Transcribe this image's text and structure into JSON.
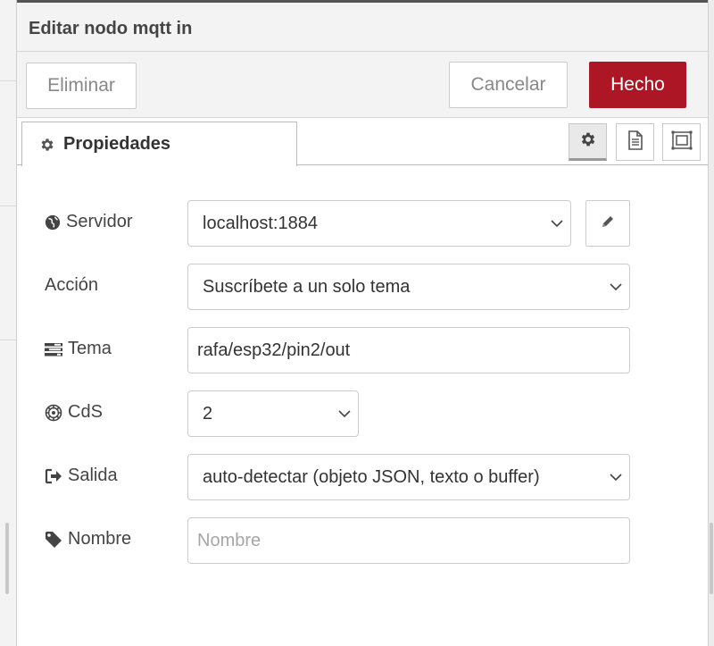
{
  "tray": {
    "title": "Editar nodo mqtt in",
    "buttons": {
      "delete": "Eliminar",
      "cancel": "Cancelar",
      "done": "Hecho"
    },
    "accent_color": "#ad1625"
  },
  "tabs": {
    "properties": "Propiedades",
    "icons": [
      "gear-icon",
      "document-icon",
      "appearance-icon"
    ]
  },
  "form": {
    "server": {
      "label": "Servidor",
      "value": "localhost:1884",
      "icon": "globe-icon"
    },
    "action": {
      "label": "Acción",
      "value": "Suscríbete a un solo tema"
    },
    "topic": {
      "label": "Tema",
      "value": "rafa/esp32/pin2/out",
      "icon": "tasks-icon"
    },
    "qos": {
      "label": "CdS",
      "value": "2",
      "icon": "empire-icon"
    },
    "output": {
      "label": "Salida",
      "value": "auto-detectar (objeto JSON, texto o buffer)",
      "icon": "sign-out-icon"
    },
    "name": {
      "label": "Nombre",
      "value": "",
      "placeholder": "Nombre",
      "icon": "tag-icon"
    }
  }
}
